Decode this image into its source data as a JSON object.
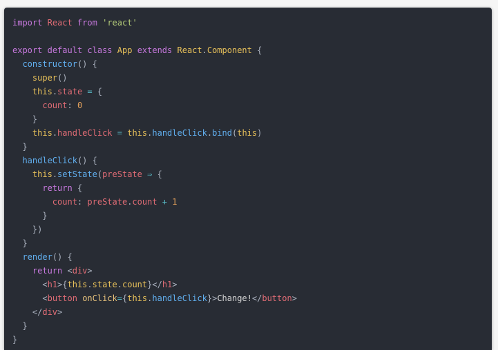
{
  "colors": {
    "page_background": "#f5f5f5",
    "editor_background": "#282c34",
    "keyword": "#c678dd",
    "string": "#b5cc7a",
    "class_name": "#e8c15a",
    "function": "#61afef",
    "this": "#e8c15a",
    "property": "#e06c75",
    "number": "#e5a25b",
    "operator": "#56b6c2",
    "jsx_tag": "#e06c75"
  },
  "code": {
    "language": "jsx",
    "lines": [
      [
        [
          "keyword",
          "import"
        ],
        [
          "plain",
          " "
        ],
        [
          "prop",
          "React"
        ],
        [
          "plain",
          " "
        ],
        [
          "keyword",
          "from"
        ],
        [
          "plain",
          " "
        ],
        [
          "string",
          "'react'"
        ]
      ],
      [],
      [
        [
          "keyword",
          "export"
        ],
        [
          "plain",
          " "
        ],
        [
          "keyword",
          "default"
        ],
        [
          "plain",
          " "
        ],
        [
          "keyword",
          "class"
        ],
        [
          "plain",
          " "
        ],
        [
          "class",
          "App"
        ],
        [
          "plain",
          " "
        ],
        [
          "keyword",
          "extends"
        ],
        [
          "plain",
          " "
        ],
        [
          "class",
          "React"
        ],
        [
          "punct",
          "."
        ],
        [
          "class",
          "Component"
        ],
        [
          "plain",
          " "
        ],
        [
          "punct",
          "{"
        ]
      ],
      [
        [
          "plain",
          "  "
        ],
        [
          "func",
          "constructor"
        ],
        [
          "punct",
          "() {"
        ]
      ],
      [
        [
          "plain",
          "    "
        ],
        [
          "this",
          "super"
        ],
        [
          "punct",
          "()"
        ]
      ],
      [
        [
          "plain",
          "    "
        ],
        [
          "this",
          "this"
        ],
        [
          "punct",
          "."
        ],
        [
          "prop",
          "state"
        ],
        [
          "plain",
          " "
        ],
        [
          "op",
          "="
        ],
        [
          "plain",
          " "
        ],
        [
          "punct",
          "{"
        ]
      ],
      [
        [
          "plain",
          "      "
        ],
        [
          "prop",
          "count"
        ],
        [
          "punct",
          ":"
        ],
        [
          "plain",
          " "
        ],
        [
          "number",
          "0"
        ]
      ],
      [
        [
          "plain",
          "    "
        ],
        [
          "punct",
          "}"
        ]
      ],
      [
        [
          "plain",
          "    "
        ],
        [
          "this",
          "this"
        ],
        [
          "punct",
          "."
        ],
        [
          "prop",
          "handleClick"
        ],
        [
          "plain",
          " "
        ],
        [
          "op",
          "="
        ],
        [
          "plain",
          " "
        ],
        [
          "this",
          "this"
        ],
        [
          "punct",
          "."
        ],
        [
          "func",
          "handleClick"
        ],
        [
          "punct",
          "."
        ],
        [
          "func",
          "bind"
        ],
        [
          "punct",
          "("
        ],
        [
          "this",
          "this"
        ],
        [
          "punct",
          ")"
        ]
      ],
      [
        [
          "plain",
          "  "
        ],
        [
          "punct",
          "}"
        ]
      ],
      [
        [
          "plain",
          "  "
        ],
        [
          "func",
          "handleClick"
        ],
        [
          "punct",
          "() {"
        ]
      ],
      [
        [
          "plain",
          "    "
        ],
        [
          "this",
          "this"
        ],
        [
          "punct",
          "."
        ],
        [
          "func",
          "setState"
        ],
        [
          "punct",
          "("
        ],
        [
          "prop",
          "preState"
        ],
        [
          "plain",
          " "
        ],
        [
          "op",
          "⇒"
        ],
        [
          "plain",
          " "
        ],
        [
          "punct",
          "{"
        ]
      ],
      [
        [
          "plain",
          "      "
        ],
        [
          "keyword",
          "return"
        ],
        [
          "plain",
          " "
        ],
        [
          "punct",
          "{"
        ]
      ],
      [
        [
          "plain",
          "        "
        ],
        [
          "prop",
          "count"
        ],
        [
          "punct",
          ":"
        ],
        [
          "plain",
          " "
        ],
        [
          "prop",
          "preState"
        ],
        [
          "punct",
          "."
        ],
        [
          "prop",
          "count"
        ],
        [
          "plain",
          " "
        ],
        [
          "op",
          "+"
        ],
        [
          "plain",
          " "
        ],
        [
          "number",
          "1"
        ]
      ],
      [
        [
          "plain",
          "      "
        ],
        [
          "punct",
          "}"
        ]
      ],
      [
        [
          "plain",
          "    "
        ],
        [
          "punct",
          "})"
        ]
      ],
      [
        [
          "plain",
          "  "
        ],
        [
          "punct",
          "}"
        ]
      ],
      [
        [
          "plain",
          "  "
        ],
        [
          "func",
          "render"
        ],
        [
          "punct",
          "() {"
        ]
      ],
      [
        [
          "plain",
          "    "
        ],
        [
          "keyword",
          "return"
        ],
        [
          "plain",
          " "
        ],
        [
          "punct",
          "<"
        ],
        [
          "tag",
          "div"
        ],
        [
          "punct",
          ">"
        ]
      ],
      [
        [
          "plain",
          "      "
        ],
        [
          "punct",
          "<"
        ],
        [
          "tag",
          "h1"
        ],
        [
          "punct",
          ">{"
        ],
        [
          "this",
          "this"
        ],
        [
          "punct",
          "."
        ],
        [
          "this",
          "state"
        ],
        [
          "punct",
          "."
        ],
        [
          "this",
          "count"
        ],
        [
          "punct",
          "}</"
        ],
        [
          "tag",
          "h1"
        ],
        [
          "punct",
          ">"
        ]
      ],
      [
        [
          "plain",
          "      "
        ],
        [
          "punct",
          "<"
        ],
        [
          "tag",
          "button"
        ],
        [
          "plain",
          " "
        ],
        [
          "attr",
          "onClick"
        ],
        [
          "op",
          "="
        ],
        [
          "punct",
          "{"
        ],
        [
          "this",
          "this"
        ],
        [
          "punct",
          "."
        ],
        [
          "func",
          "handleClick"
        ],
        [
          "punct",
          "}>"
        ],
        [
          "text",
          "Change!"
        ],
        [
          "punct",
          "</"
        ],
        [
          "tag",
          "button"
        ],
        [
          "punct",
          ">"
        ]
      ],
      [
        [
          "plain",
          "    "
        ],
        [
          "punct",
          "</"
        ],
        [
          "tag",
          "div"
        ],
        [
          "punct",
          ">"
        ]
      ],
      [
        [
          "plain",
          "  "
        ],
        [
          "punct",
          "}"
        ]
      ],
      [
        [
          "punct",
          "}"
        ]
      ]
    ]
  }
}
